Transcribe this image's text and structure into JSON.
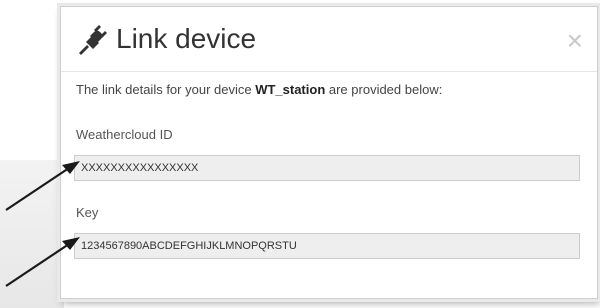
{
  "dialog": {
    "title": "Link device",
    "close_symbol": "×",
    "intro_prefix": "The link details for your device ",
    "device_name": "WT_station",
    "intro_suffix": " are provided below:"
  },
  "fields": {
    "weathercloud_id": {
      "label": "Weathercloud ID",
      "value": "XXXXXXXXXXXXXXXX"
    },
    "key": {
      "label": "Key",
      "value": "1234567890ABCDEFGHIJKLMNOPQRSTU"
    }
  },
  "icons": {
    "title_icon": "plug-icon",
    "annotation": "arrow-icon"
  },
  "colors": {
    "field_background": "#eeeeee",
    "title_text": "#333333",
    "arrow": "#1a1a1a"
  }
}
